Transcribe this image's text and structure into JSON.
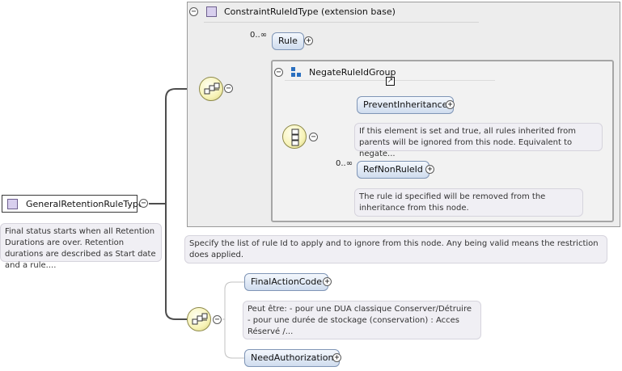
{
  "root": {
    "name": "GeneralRetentionRuleType",
    "doc": "Final status starts when all Retention Durations are over. Retention durations are described as Start date and a rule...."
  },
  "extension": {
    "title": "ConstraintRuleIdType (extension base)",
    "doc": "Specify the list of rule Id to apply and to ignore from this node. Any being valid means the restriction does applied."
  },
  "rule": {
    "name": "Rule",
    "cardinality": "0..∞"
  },
  "group": {
    "name": "NegateRuleIdGroup"
  },
  "prevent": {
    "name": "PreventInheritance",
    "doc": "If this element is set and true, all rules inherited from parents will be ignored from this node. Equivalent to negate..."
  },
  "refnon": {
    "name": "RefNonRuleId",
    "cardinality": "0..∞",
    "doc": "The rule id specified will be removed from the inheritance from this node."
  },
  "final_action": {
    "name": "FinalActionCode",
    "doc": "Peut être: - pour une DUA classique Conserver/Détruire - pour une durée de stockage (conservation) : Acces Réservé /..."
  },
  "need_auth": {
    "name": "NeedAuthorization"
  },
  "symbols": {
    "minus": "−",
    "plus": "+"
  }
}
